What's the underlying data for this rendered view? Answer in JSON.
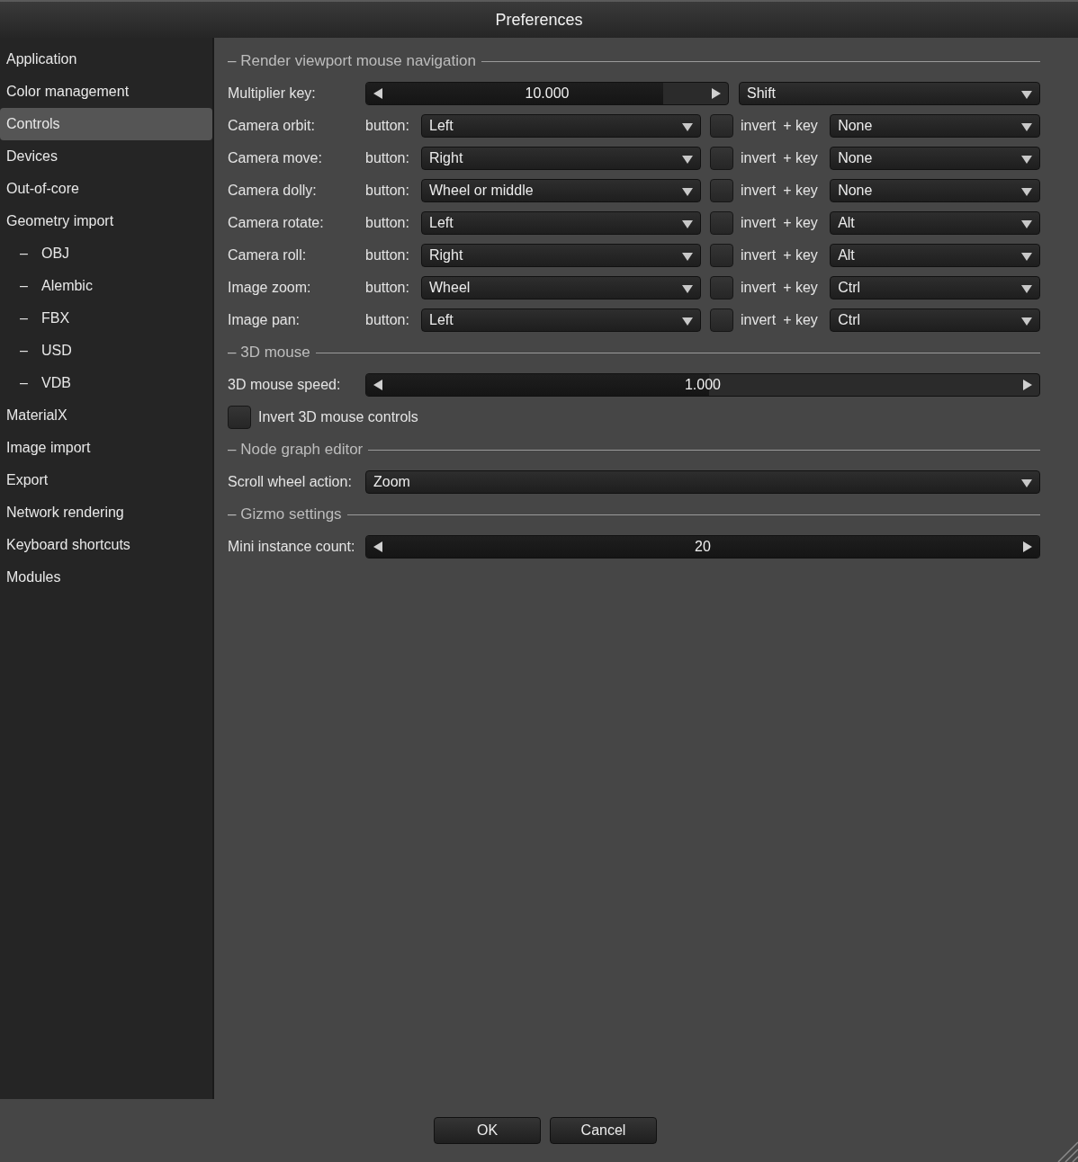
{
  "window": {
    "title": "Preferences"
  },
  "sidebar": {
    "items": [
      {
        "label": "Application",
        "selected": false
      },
      {
        "label": "Color management",
        "selected": false
      },
      {
        "label": "Controls",
        "selected": true
      },
      {
        "label": "Devices",
        "selected": false
      },
      {
        "label": "Out-of-core",
        "selected": false
      },
      {
        "label": "Geometry import",
        "selected": false,
        "children": [
          {
            "marker": "–",
            "label": "OBJ",
            "selected": false
          },
          {
            "marker": "–",
            "label": "Alembic",
            "selected": false
          },
          {
            "marker": "–",
            "label": "FBX",
            "selected": false
          },
          {
            "marker": "–",
            "label": "USD",
            "selected": false
          },
          {
            "marker": "–",
            "label": "VDB",
            "selected": false
          }
        ]
      },
      {
        "label": "MaterialX",
        "selected": false
      },
      {
        "label": "Image import",
        "selected": false
      },
      {
        "label": "Export",
        "selected": false
      },
      {
        "label": "Network rendering",
        "selected": false
      },
      {
        "label": "Keyboard shortcuts",
        "selected": false
      },
      {
        "label": "Modules",
        "selected": false
      }
    ]
  },
  "sections": [
    {
      "title": "– Render viewport mouse navigation",
      "rows": [
        {
          "kind": "slider_dropdown",
          "label": "Multiplier key:",
          "value": "10.000",
          "level": 0.82,
          "key": "Shift"
        },
        {
          "kind": "binding",
          "label": "Camera orbit:",
          "button_label": "button:",
          "button": "Left",
          "invert": false,
          "invert_label": "invert",
          "key_label": "+ key",
          "key": "None"
        },
        {
          "kind": "binding",
          "label": "Camera move:",
          "button_label": "button:",
          "button": "Right",
          "invert": false,
          "invert_label": "invert",
          "key_label": "+ key",
          "key": "None"
        },
        {
          "kind": "binding",
          "label": "Camera dolly:",
          "button_label": "button:",
          "button": "Wheel or middle",
          "invert": false,
          "invert_label": "invert",
          "key_label": "+ key",
          "key": "None"
        },
        {
          "kind": "binding",
          "label": "Camera rotate:",
          "button_label": "button:",
          "button": "Left",
          "invert": false,
          "invert_label": "invert",
          "key_label": "+ key",
          "key": "Alt"
        },
        {
          "kind": "binding",
          "label": "Camera roll:",
          "button_label": "button:",
          "button": "Right",
          "invert": false,
          "invert_label": "invert",
          "key_label": "+ key",
          "key": "Alt"
        },
        {
          "kind": "binding",
          "label": "Image zoom:",
          "button_label": "button:",
          "button": "Wheel",
          "invert": false,
          "invert_label": "invert",
          "key_label": "+ key",
          "key": "Ctrl"
        },
        {
          "kind": "binding",
          "label": "Image pan:",
          "button_label": "button:",
          "button": "Left",
          "invert": false,
          "invert_label": "invert",
          "key_label": "+ key",
          "key": "Ctrl"
        }
      ]
    },
    {
      "title": "– 3D mouse",
      "rows": [
        {
          "kind": "slider",
          "label": "3D mouse speed:",
          "value": "1.000",
          "level": 0.51
        },
        {
          "kind": "checkbox",
          "label": "Invert 3D mouse controls",
          "checked": false
        }
      ]
    },
    {
      "title": "– Node graph editor",
      "rows": [
        {
          "kind": "dropdown",
          "label": "Scroll wheel action:",
          "value": "Zoom"
        }
      ]
    },
    {
      "title": "– Gizmo settings",
      "rows": [
        {
          "kind": "slider",
          "label": "Mini instance count:",
          "value": "20",
          "level": 1
        }
      ]
    }
  ],
  "buttons": [
    "OK",
    "Cancel"
  ]
}
